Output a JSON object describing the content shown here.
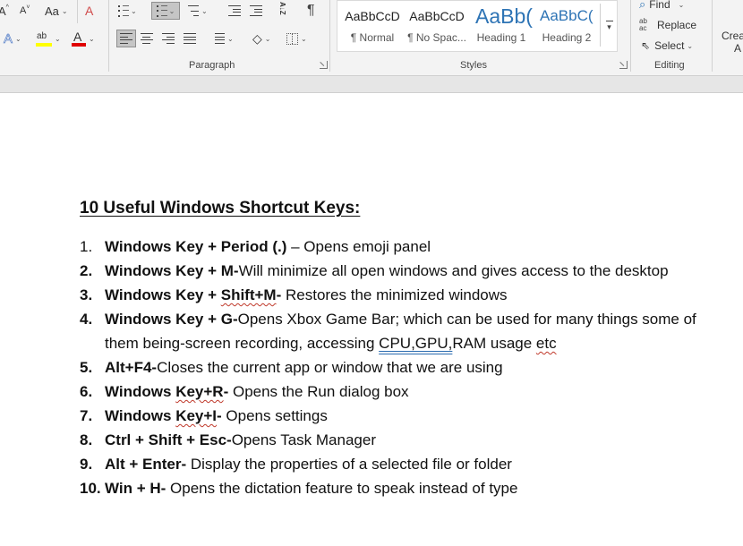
{
  "ribbon": {
    "font_group": {
      "grow_font": "A",
      "shrink_font": "A",
      "change_case": "Aa",
      "text_effects": "A",
      "highlight": "ab",
      "font_color": "A"
    },
    "paragraph_group": {
      "label": "Paragraph",
      "sort_label": "A↓Z",
      "show_marks": "¶"
    },
    "styles_group": {
      "label": "Styles",
      "tiles": [
        {
          "sample": "AaBbCcD",
          "name": "¶ Normal"
        },
        {
          "sample": "AaBbCcD",
          "name": "¶ No Spac..."
        },
        {
          "sample": "AaBb(",
          "name": "Heading 1"
        },
        {
          "sample": "AaBbC(",
          "name": "Heading 2"
        }
      ]
    },
    "editing_group": {
      "label": "Editing",
      "find": "Find",
      "replace": "Replace",
      "select": "Select",
      "replace_icon": "ab ac"
    },
    "next_group": {
      "line1": "Crea",
      "line2": "A"
    }
  },
  "document": {
    "title": "10 Useful Windows Shortcut Keys:",
    "items": [
      {
        "num": "1.",
        "shortcut": "Windows Key + Period (.)",
        "desc": " – Opens emoji panel"
      },
      {
        "num": "2.",
        "shortcut": "Windows Key + M-",
        "desc": "Will minimize all open windows and gives access to the desktop"
      },
      {
        "num": "3.",
        "shortcut_a": "Windows Key + ",
        "shortcut_b": "Shift+M",
        "shortcut_c": "-",
        "desc": " Restores the minimized windows"
      },
      {
        "num": "4.",
        "shortcut": "Windows Key + G-",
        "desc_a": "Opens Xbox Game Bar; which can be used for many things some of them being-screen recording, accessing ",
        "desc_b": "CPU,GPU,",
        "desc_c": "RAM usage ",
        "desc_d": "etc"
      },
      {
        "num": "5.",
        "shortcut": "Alt+F4-",
        "desc": "Closes the current app or window that we are using"
      },
      {
        "num": "6.",
        "shortcut_a": "Windows ",
        "shortcut_b": "Key+R",
        "shortcut_c": "-",
        "desc": " Opens the Run dialog box"
      },
      {
        "num": "7.",
        "shortcut_a": "Windows ",
        "shortcut_b": "Key+I",
        "shortcut_c": "-",
        "desc": " Opens settings"
      },
      {
        "num": "8.",
        "shortcut": "Ctrl + Shift + Esc-",
        "desc": "Opens Task Manager"
      },
      {
        "num": "9.",
        "shortcut": "Alt + Enter-",
        "desc": " Display the properties of a selected file or folder"
      },
      {
        "num": "10.",
        "shortcut": "Win + H-",
        "desc": " Opens the dictation feature to speak instead of type"
      }
    ]
  },
  "colors": {
    "ribbon_bg": "#f3f3f3",
    "heading_blue": "#2e74b5",
    "text_effects_blue": "#4472c4",
    "highlight_yellow": "#ffff00",
    "font_color_red": "#e00000",
    "spell_red": "#c0392b",
    "grammar_blue": "#2b6cb0"
  }
}
